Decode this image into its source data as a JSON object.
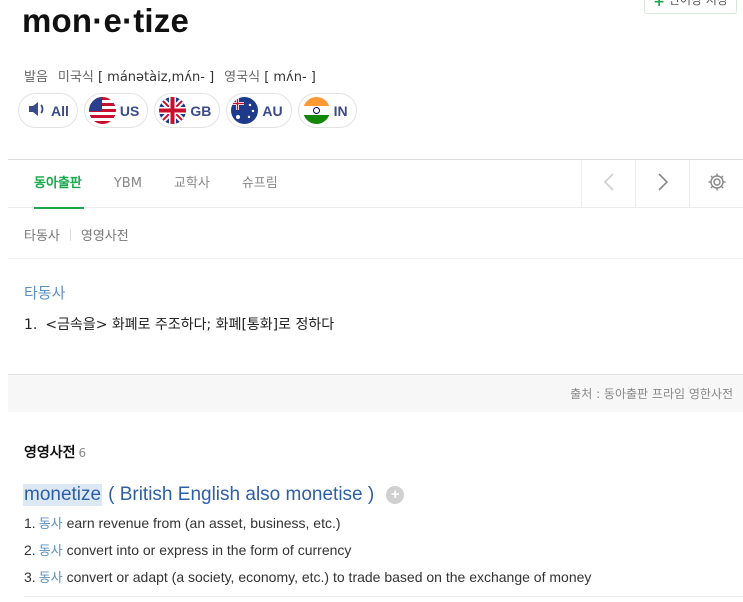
{
  "top_button": {
    "label": "단어장 저장"
  },
  "headword": "mon·e·tize",
  "pronunciation": {
    "label": "발음",
    "us_label": "미국식",
    "us_ipa": "[ mánətàiz,mʌ́n- ]",
    "uk_label": "영국식",
    "uk_ipa": "[ mʌ́n- ]"
  },
  "audio": [
    {
      "label": "All",
      "icon": "speaker-icon"
    },
    {
      "label": "US",
      "icon": "flag-us-icon"
    },
    {
      "label": "GB",
      "icon": "flag-gb-icon"
    },
    {
      "label": "AU",
      "icon": "flag-au-icon"
    },
    {
      "label": "IN",
      "icon": "flag-in-icon"
    }
  ],
  "tabs": [
    {
      "label": "동아출판",
      "active": true
    },
    {
      "label": "YBM"
    },
    {
      "label": "교학사"
    },
    {
      "label": "슈프림"
    }
  ],
  "tools": [
    "chevron-left-icon",
    "chevron-right-icon",
    "gear-icon"
  ],
  "subnav": [
    "타동사",
    "영영사전"
  ],
  "dong_a": {
    "pos": "타동사",
    "senses": [
      {
        "num": "1.",
        "text": "<금속을> 화폐로 주조하다; 화폐[통화]로 정하다"
      }
    ]
  },
  "source": "출처 : 동아출판 프라임 영한사전",
  "english_dict": {
    "title": "영영사전",
    "count": "6",
    "word": "monetize",
    "variant": "( British English also monetise )",
    "definitions": [
      {
        "num": "1.",
        "pos": "동사",
        "text": "earn revenue from (an asset, business, etc.)"
      },
      {
        "num": "2.",
        "pos": "동사",
        "text": "convert into or express in the form of currency"
      },
      {
        "num": "3.",
        "pos": "동사",
        "text": "convert or adapt (a society, economy, etc.) to trade based on the exchange of money"
      }
    ]
  },
  "colors": {
    "accent_green": "#19a84a",
    "link_blue": "#2e5fa5",
    "pos_blue": "#5b8fc2"
  }
}
